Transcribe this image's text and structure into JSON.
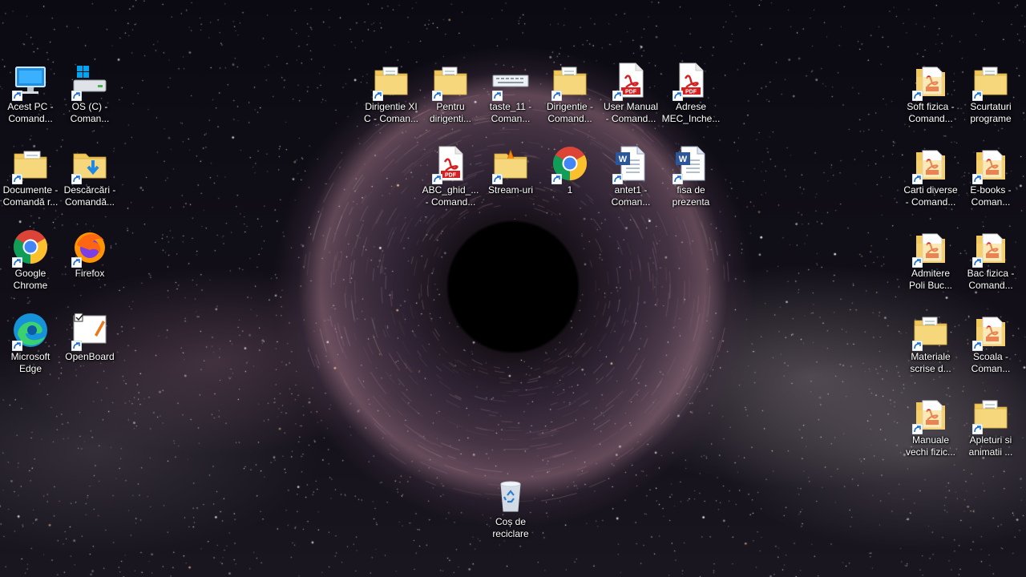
{
  "desktop": {
    "icons_left": [
      {
        "label": "Acest PC -\nComand...",
        "icon": "computer-icon"
      },
      {
        "label": "OS (C) -\nComan...",
        "icon": "drive-icon"
      },
      {
        "label": "Documente -\nComandă r...",
        "icon": "documents-folder-icon"
      },
      {
        "label": "Descărcări -\nComandă...",
        "icon": "downloads-folder-icon"
      },
      {
        "label": "Google\nChrome",
        "icon": "chrome-icon"
      },
      {
        "label": "Firefox",
        "icon": "firefox-icon"
      },
      {
        "label": "Microsoft\nEdge",
        "icon": "edge-icon"
      },
      {
        "label": "OpenBoard",
        "icon": "openboard-icon"
      }
    ],
    "icons_center": [
      {
        "label": "Dirigentie XI\nC - Coman...",
        "icon": "folder-icon"
      },
      {
        "label": "Pentru\ndirigenti...",
        "icon": "folder-icon"
      },
      {
        "label": "taste_11 -\nComan...",
        "icon": "keyboard-icon"
      },
      {
        "label": "Dirigentie -\nComand...",
        "icon": "folder-icon"
      },
      {
        "label": "User Manual\n- Comand...",
        "icon": "pdf-icon"
      },
      {
        "label": "Adrese\nMEC_Inche...",
        "icon": "pdf-icon"
      },
      {
        "label": "ABC_ghid_...\n- Comand...",
        "icon": "pdf-icon"
      },
      {
        "label": "Stream-uri",
        "icon": "vlc-folder-icon"
      },
      {
        "label": "1",
        "icon": "chrome-icon"
      },
      {
        "label": "antet1 -\nComan...",
        "icon": "word-doc-icon"
      },
      {
        "label": "fisa de\nprezenta",
        "icon": "word-doc-icon"
      }
    ],
    "icons_right": [
      {
        "label": "Soft fizica -\nComand...",
        "icon": "pdf-folder-icon"
      },
      {
        "label": "Scurtaturi\nprograme",
        "icon": "folder-icon"
      },
      {
        "label": "Carti diverse\n- Comand...",
        "icon": "pdf-folder-icon"
      },
      {
        "label": "E-books -\nComan...",
        "icon": "pdf-folder-icon"
      },
      {
        "label": "Admitere\nPoli Buc...",
        "icon": "pdf-folder-icon"
      },
      {
        "label": "Bac fizica -\nComand...",
        "icon": "pdf-folder-icon"
      },
      {
        "label": "Materiale\nscrise d...",
        "icon": "folder-icon"
      },
      {
        "label": "Scoala -\nComan...",
        "icon": "pdf-folder-icon"
      },
      {
        "label": "Manuale\nvechi fizic...",
        "icon": "pdf-folder-icon"
      },
      {
        "label": "Apleturi si\nanimatii ...",
        "icon": "folder-icon"
      }
    ],
    "recycle_bin": {
      "label": "Coș de\nreciclare",
      "icon": "recycle-bin-icon"
    }
  },
  "colors": {
    "folder": "#f3c85a",
    "pdf_red": "#d42020",
    "word_blue": "#2b579a",
    "shortcut_arrow": "#1e6fd9"
  }
}
